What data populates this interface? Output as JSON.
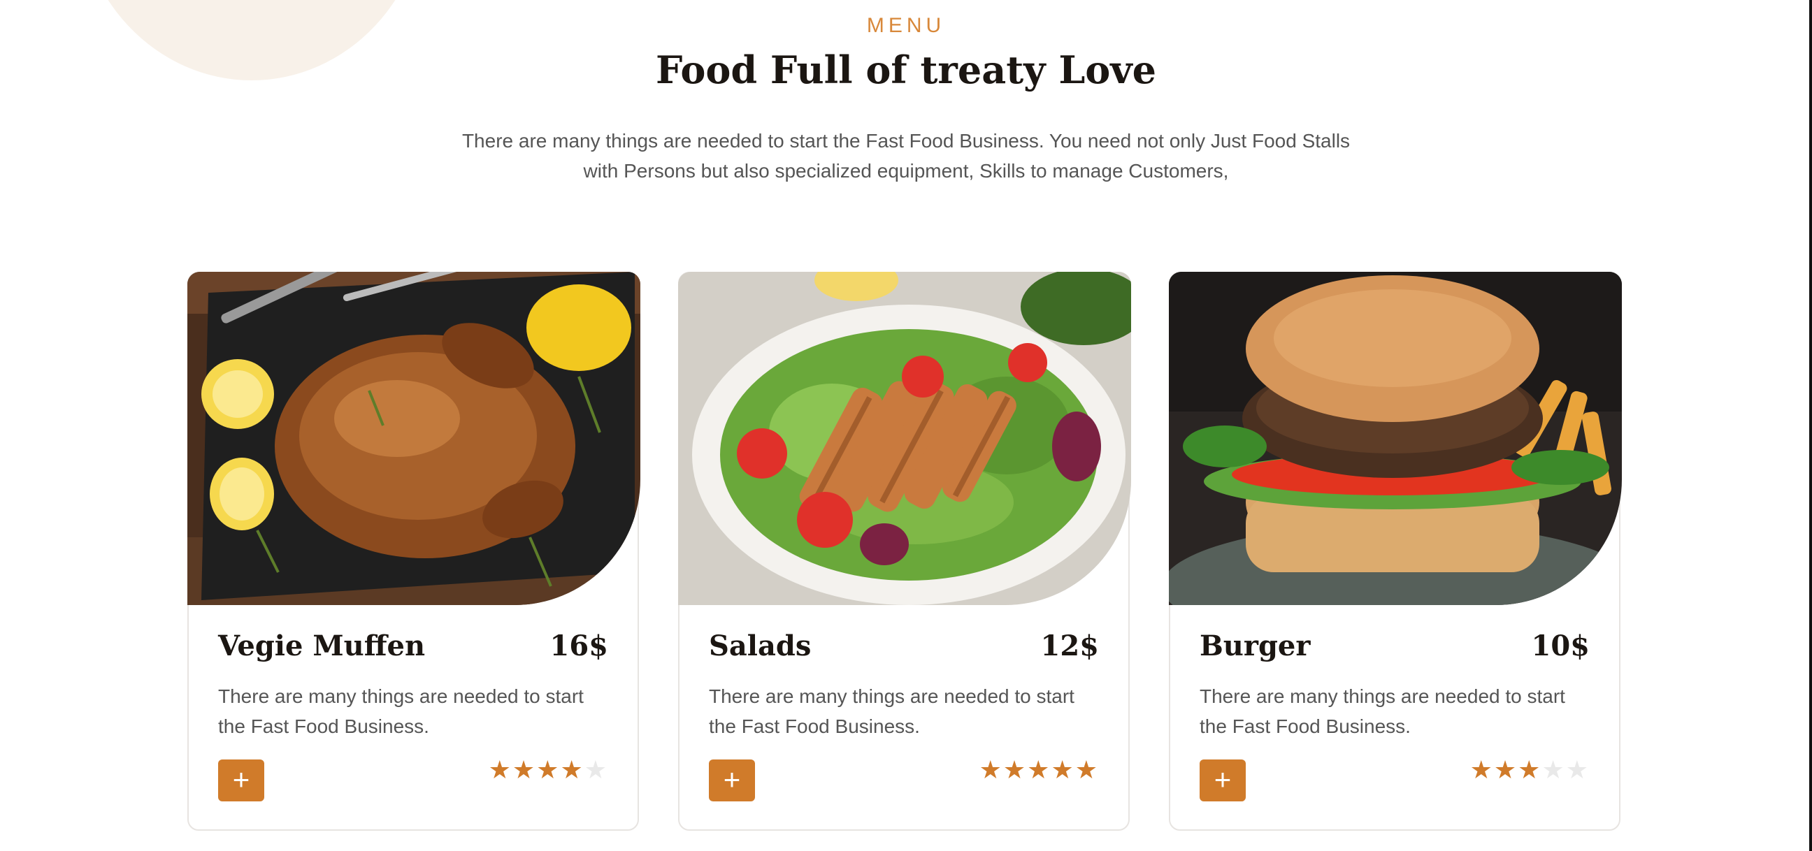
{
  "section": {
    "eyebrow": "MENU",
    "title": "Food Full of treaty Love",
    "intro_line1": "There are many things are needed to start the Fast Food Business. You need not only Just Food Stalls",
    "intro_line2": "with Persons but also specialized equipment, Skills to manage Customers,"
  },
  "cards": [
    {
      "title": "Vegie Muffen",
      "price": "16$",
      "desc_line1": "There are many things are needed to start",
      "desc_line2": "the Fast Food Business.",
      "add_label": "+",
      "rating": 4,
      "rating_max": 5,
      "image": "roast-chicken-photo"
    },
    {
      "title": "Salads",
      "price": "12$",
      "desc_line1": "There are many things are needed to start",
      "desc_line2": "the Fast Food Business.",
      "add_label": "+",
      "rating": 5,
      "rating_max": 5,
      "image": "chicken-salad-photo"
    },
    {
      "title": "Burger",
      "price": "10$",
      "desc_line1": "There are many things are needed to start",
      "desc_line2": "the Fast Food Business.",
      "add_label": "+",
      "rating": 3,
      "rating_max": 5,
      "image": "veggie-burger-photo"
    }
  ],
  "colors": {
    "accent": "#d07b2a",
    "eyebrow": "#d8883a",
    "star_empty": "#e9e9e9",
    "heading": "#1b1612"
  },
  "icons": {
    "add": "plus-icon",
    "rating": "star-icon"
  }
}
